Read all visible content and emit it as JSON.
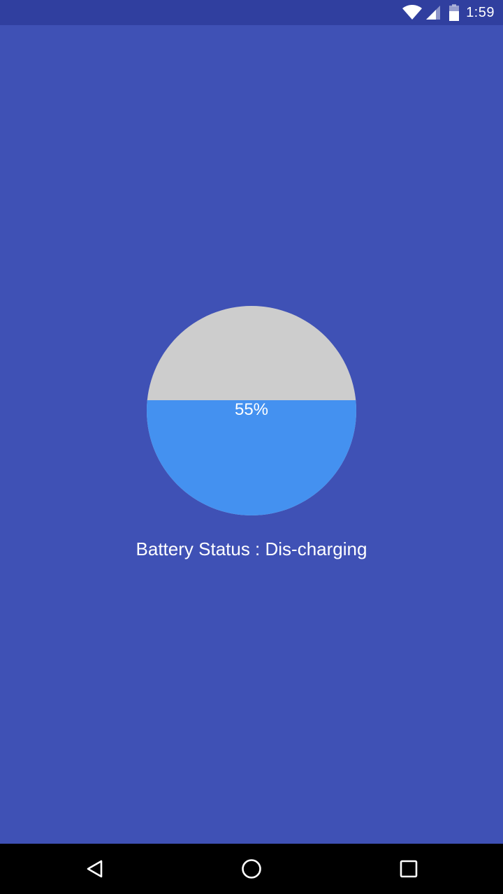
{
  "status_bar": {
    "time": "1:59",
    "icons": [
      "wifi-icon",
      "signal-icon",
      "battery-icon"
    ]
  },
  "battery": {
    "percent_label": "55%",
    "level_fraction": 0.55,
    "status_text": "Battery Status : Dis-charging",
    "fill_color": "#4491f0",
    "empty_color": "#cdcdcd"
  },
  "colors": {
    "background": "#3f51b5",
    "status_bar": "#303f9f",
    "nav_bar": "#000000"
  },
  "nav_bar": {
    "buttons": [
      "back-icon",
      "home-icon",
      "recents-icon"
    ]
  }
}
